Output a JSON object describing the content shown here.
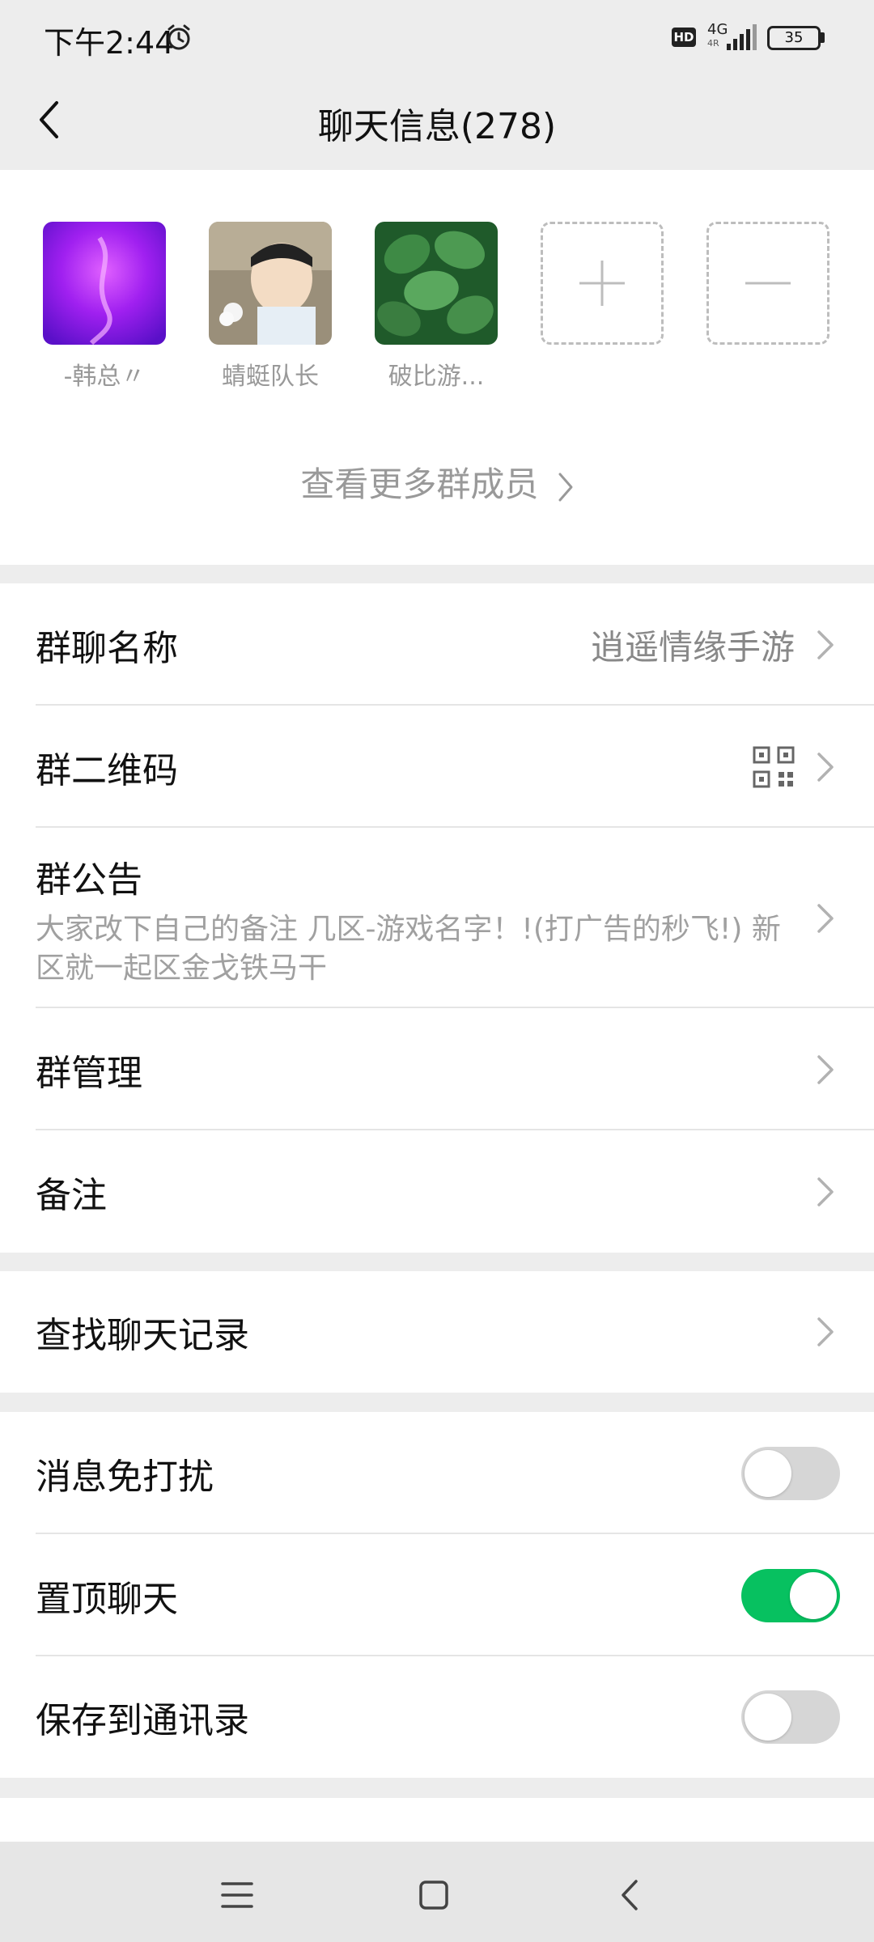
{
  "status_bar": {
    "time": "下午2:44",
    "hd": "HD",
    "network": "4G",
    "network_sub": "4R",
    "battery": "35"
  },
  "header": {
    "title": "聊天信息(278)"
  },
  "members": {
    "list": [
      {
        "name": "-韩总〃"
      },
      {
        "name": "蜻蜓队长"
      },
      {
        "name": "破比游..."
      }
    ],
    "more_label": "查看更多群成员"
  },
  "group_section": {
    "name_label": "群聊名称",
    "name_value": "逍遥情缘手游",
    "qr_label": "群二维码",
    "notice_label": "群公告",
    "notice_text": "大家改下自己的备注 几区-游戏名字！!(打广告的秒飞!) 新区就一起区金戈铁马干",
    "manage_label": "群管理",
    "remark_label": "备注"
  },
  "search_section": {
    "search_label": "查找聊天记录"
  },
  "settings_section": {
    "mute_label": "消息免打扰",
    "mute_on": false,
    "pin_label": "置顶聊天",
    "pin_on": true,
    "save_label": "保存到通讯录",
    "save_on": false
  },
  "colors": {
    "accent_green": "#07c160",
    "background": "#ededed"
  }
}
